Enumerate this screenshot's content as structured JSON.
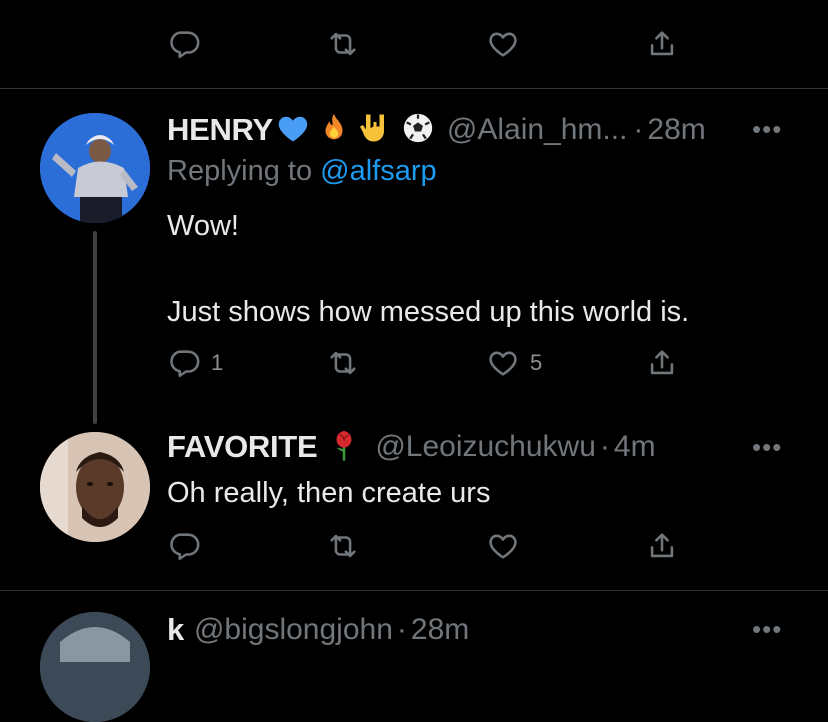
{
  "top_actions": {
    "reply": "",
    "retweet": "",
    "like": "",
    "share": ""
  },
  "tweets": [
    {
      "name": "HENRY",
      "handle": "@Alain_hm...",
      "sep": "·",
      "time": "28m",
      "replying_prefix": "Replying to",
      "replying_to": "@alfsarp",
      "text": "Wow!\n\nJust shows how messed up this world is.",
      "reply_count": "1",
      "like_count": "5"
    },
    {
      "name": "FAVORITE",
      "handle": "@Leoizuchukwu",
      "sep": "·",
      "time": "4m",
      "text": "Oh really, then create urs"
    },
    {
      "name": "k",
      "handle": "@bigslongjohn",
      "sep": "·",
      "time": "28m"
    }
  ],
  "more_label": "•••",
  "colors": {
    "background": "#000000",
    "link": "#1d9bf0",
    "muted": "#71767b",
    "divider": "#2f3336"
  }
}
